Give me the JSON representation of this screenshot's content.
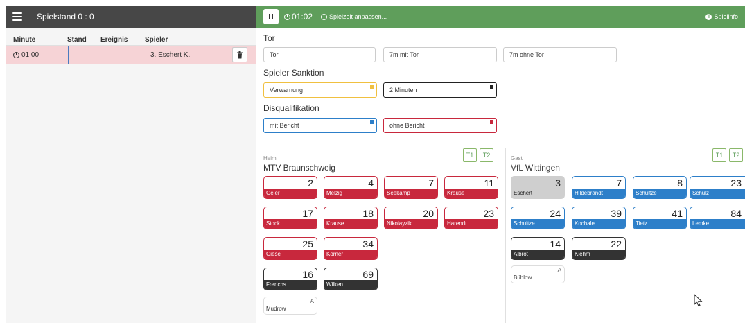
{
  "left_panel": {
    "score_title": "Spielstand 0 : 0",
    "columns": {
      "minute": "Minute",
      "stand": "Stand",
      "ereignis": "Ereignis",
      "spieler": "Spieler"
    },
    "events": [
      {
        "time": "01:00",
        "player": "3. Eschert K."
      }
    ]
  },
  "top_bar": {
    "timer": "01:02",
    "adjust": "Spielzeit anpassen...",
    "info": "Spielinfo",
    "color": "#5f9e5b"
  },
  "sections": {
    "tor": {
      "title": "Tor",
      "buttons": [
        "Tor",
        "7m mit Tor",
        "7m ohne Tor"
      ]
    },
    "sanktion": {
      "title": "Spieler Sanktion",
      "buttons": [
        "Verwarnung",
        "2 Minuten"
      ]
    },
    "disq": {
      "title": "Disqualifikation",
      "buttons": [
        "mit Bericht",
        "ohne Bericht"
      ]
    }
  },
  "home": {
    "label": "Heim",
    "name": "MTV Braunschweig",
    "t1": "T1",
    "t2": "T2",
    "players": [
      {
        "number": "2",
        "name": "Geier"
      },
      {
        "number": "4",
        "name": "Melzig"
      },
      {
        "number": "7",
        "name": "Seekamp"
      },
      {
        "number": "11",
        "name": "Krause"
      },
      {
        "number": "17",
        "name": "Stock"
      },
      {
        "number": "18",
        "name": "Krause"
      },
      {
        "number": "20",
        "name": "Nikolayzik"
      },
      {
        "number": "23",
        "name": "Harendt"
      },
      {
        "number": "25",
        "name": "Giese"
      },
      {
        "number": "34",
        "name": "Körner"
      }
    ],
    "goalkeepers": [
      {
        "number": "16",
        "name": "Frerichs"
      },
      {
        "number": "69",
        "name": "Wilken"
      }
    ],
    "official": {
      "role": "A",
      "name": "Mudrow"
    }
  },
  "guest": {
    "label": "Gast",
    "name": "VfL Wittingen",
    "t1": "T1",
    "t2": "T2",
    "players": [
      {
        "number": "3",
        "name": "Eschert"
      },
      {
        "number": "7",
        "name": "Hildebrandt"
      },
      {
        "number": "8",
        "name": "Schultze"
      },
      {
        "number": "23",
        "name": "Schulz"
      },
      {
        "number": "24",
        "name": "Schultze"
      },
      {
        "number": "39",
        "name": "Kochale"
      },
      {
        "number": "41",
        "name": "Tietz"
      },
      {
        "number": "84",
        "name": "Lemke"
      }
    ],
    "goalkeepers": [
      {
        "number": "14",
        "name": "Albrot"
      },
      {
        "number": "22",
        "name": "Kiehm"
      }
    ],
    "official": {
      "role": "A",
      "name": "Bühlow"
    }
  },
  "colors": {
    "home": "#c8283d",
    "guest": "#2d7fc9",
    "goalkeeper": "#333333",
    "suspended": "#cfcfcf",
    "warning": "#f0c040"
  }
}
